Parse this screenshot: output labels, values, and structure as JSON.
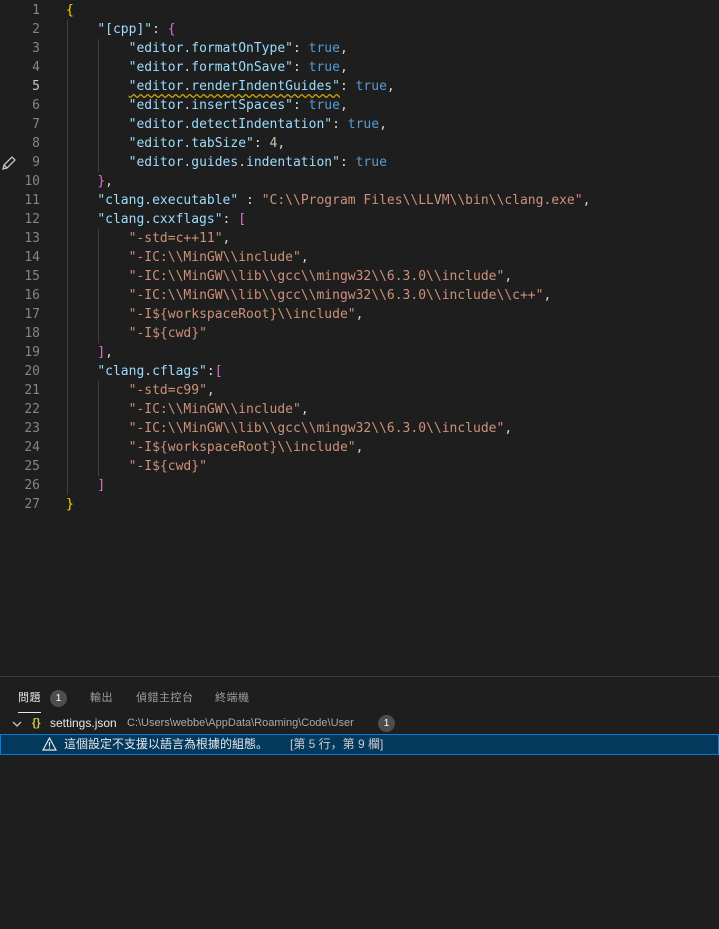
{
  "editor": {
    "active_line": 5,
    "pencil_icon": "pencil-icon",
    "lines": [
      {
        "n": "1",
        "tokens": [
          {
            "t": "{",
            "c": "t-b1"
          }
        ]
      },
      {
        "n": "2",
        "tokens": [
          {
            "t": "    "
          },
          {
            "t": "\"[cpp]\"",
            "c": "t-key"
          },
          {
            "t": ": ",
            "c": "t-p"
          },
          {
            "t": "{",
            "c": "t-b2"
          }
        ]
      },
      {
        "n": "3",
        "tokens": [
          {
            "t": "        "
          },
          {
            "t": "\"editor.formatOnType\"",
            "c": "t-key"
          },
          {
            "t": ": ",
            "c": "t-p"
          },
          {
            "t": "true",
            "c": "t-kw"
          },
          {
            "t": ",",
            "c": "t-p"
          }
        ]
      },
      {
        "n": "4",
        "tokens": [
          {
            "t": "        "
          },
          {
            "t": "\"editor.formatOnSave\"",
            "c": "t-key"
          },
          {
            "t": ": ",
            "c": "t-p"
          },
          {
            "t": "true",
            "c": "t-kw"
          },
          {
            "t": ",",
            "c": "t-p"
          }
        ]
      },
      {
        "n": "5",
        "tokens": [
          {
            "t": "        "
          },
          {
            "t": "\"editor.renderIndentGuides\"",
            "c": "t-key squiggle"
          },
          {
            "t": ": ",
            "c": "t-p"
          },
          {
            "t": "true",
            "c": "t-kw"
          },
          {
            "t": ",",
            "c": "t-p"
          }
        ]
      },
      {
        "n": "6",
        "tokens": [
          {
            "t": "        "
          },
          {
            "t": "\"editor.insertSpaces\"",
            "c": "t-key"
          },
          {
            "t": ": ",
            "c": "t-p"
          },
          {
            "t": "true",
            "c": "t-kw"
          },
          {
            "t": ",",
            "c": "t-p"
          }
        ]
      },
      {
        "n": "7",
        "tokens": [
          {
            "t": "        "
          },
          {
            "t": "\"editor.detectIndentation\"",
            "c": "t-key"
          },
          {
            "t": ": ",
            "c": "t-p"
          },
          {
            "t": "true",
            "c": "t-kw"
          },
          {
            "t": ",",
            "c": "t-p"
          }
        ]
      },
      {
        "n": "8",
        "tokens": [
          {
            "t": "        "
          },
          {
            "t": "\"editor.tabSize\"",
            "c": "t-key"
          },
          {
            "t": ": ",
            "c": "t-p"
          },
          {
            "t": "4",
            "c": "t-num"
          },
          {
            "t": ",",
            "c": "t-p"
          }
        ]
      },
      {
        "n": "9",
        "tokens": [
          {
            "t": "        "
          },
          {
            "t": "\"editor.guides.indentation\"",
            "c": "t-key"
          },
          {
            "t": ": ",
            "c": "t-p"
          },
          {
            "t": "true",
            "c": "t-kw"
          }
        ]
      },
      {
        "n": "10",
        "tokens": [
          {
            "t": "    "
          },
          {
            "t": "}",
            "c": "t-b2"
          },
          {
            "t": ",",
            "c": "t-p"
          }
        ]
      },
      {
        "n": "11",
        "tokens": [
          {
            "t": "    "
          },
          {
            "t": "\"clang.executable\"",
            "c": "t-key"
          },
          {
            "t": " : ",
            "c": "t-p"
          },
          {
            "t": "\"C:\\\\Program Files\\\\LLVM\\\\bin\\\\clang.exe\"",
            "c": "t-str"
          },
          {
            "t": ",",
            "c": "t-p"
          }
        ]
      },
      {
        "n": "12",
        "tokens": [
          {
            "t": "    "
          },
          {
            "t": "\"clang.cxxflags\"",
            "c": "t-key"
          },
          {
            "t": ": ",
            "c": "t-p"
          },
          {
            "t": "[",
            "c": "t-b2"
          }
        ]
      },
      {
        "n": "13",
        "tokens": [
          {
            "t": "        "
          },
          {
            "t": "\"-std=c++11\"",
            "c": "t-str"
          },
          {
            "t": ",",
            "c": "t-p"
          }
        ]
      },
      {
        "n": "14",
        "tokens": [
          {
            "t": "        "
          },
          {
            "t": "\"-IC:\\\\MinGW\\\\include\"",
            "c": "t-str"
          },
          {
            "t": ",",
            "c": "t-p"
          }
        ]
      },
      {
        "n": "15",
        "tokens": [
          {
            "t": "        "
          },
          {
            "t": "\"-IC:\\\\MinGW\\\\lib\\\\gcc\\\\mingw32\\\\6.3.0\\\\include\"",
            "c": "t-str"
          },
          {
            "t": ",",
            "c": "t-p"
          }
        ]
      },
      {
        "n": "16",
        "tokens": [
          {
            "t": "        "
          },
          {
            "t": "\"-IC:\\\\MinGW\\\\lib\\\\gcc\\\\mingw32\\\\6.3.0\\\\include\\\\c++\"",
            "c": "t-str"
          },
          {
            "t": ",",
            "c": "t-p"
          }
        ]
      },
      {
        "n": "17",
        "tokens": [
          {
            "t": "        "
          },
          {
            "t": "\"-I${workspaceRoot}\\\\include\"",
            "c": "t-str"
          },
          {
            "t": ",",
            "c": "t-p"
          }
        ]
      },
      {
        "n": "18",
        "tokens": [
          {
            "t": "        "
          },
          {
            "t": "\"-I${cwd}\"",
            "c": "t-str"
          }
        ]
      },
      {
        "n": "19",
        "tokens": [
          {
            "t": "    "
          },
          {
            "t": "]",
            "c": "t-b2"
          },
          {
            "t": ",",
            "c": "t-p"
          }
        ]
      },
      {
        "n": "20",
        "tokens": [
          {
            "t": "    "
          },
          {
            "t": "\"clang.cflags\"",
            "c": "t-key"
          },
          {
            "t": ":",
            "c": "t-p"
          },
          {
            "t": "[",
            "c": "t-b2"
          }
        ]
      },
      {
        "n": "21",
        "tokens": [
          {
            "t": "        "
          },
          {
            "t": "\"-std=c99\"",
            "c": "t-str"
          },
          {
            "t": ",",
            "c": "t-p"
          }
        ]
      },
      {
        "n": "22",
        "tokens": [
          {
            "t": "        "
          },
          {
            "t": "\"-IC:\\\\MinGW\\\\include\"",
            "c": "t-str"
          },
          {
            "t": ",",
            "c": "t-p"
          }
        ]
      },
      {
        "n": "23",
        "tokens": [
          {
            "t": "        "
          },
          {
            "t": "\"-IC:\\\\MinGW\\\\lib\\\\gcc\\\\mingw32\\\\6.3.0\\\\include\"",
            "c": "t-str"
          },
          {
            "t": ",",
            "c": "t-p"
          }
        ]
      },
      {
        "n": "24",
        "tokens": [
          {
            "t": "        "
          },
          {
            "t": "\"-I${workspaceRoot}\\\\include\"",
            "c": "t-str"
          },
          {
            "t": ",",
            "c": "t-p"
          }
        ]
      },
      {
        "n": "25",
        "tokens": [
          {
            "t": "        "
          },
          {
            "t": "\"-I${cwd}\"",
            "c": "t-str"
          }
        ]
      },
      {
        "n": "26",
        "tokens": [
          {
            "t": "    "
          },
          {
            "t": "]",
            "c": "t-b2"
          }
        ]
      },
      {
        "n": "27",
        "tokens": [
          {
            "t": "}",
            "c": "t-b1"
          }
        ]
      }
    ]
  },
  "panel": {
    "tabs": {
      "problems": "問題",
      "problems_count": "1",
      "output": "輸出",
      "debug_console": "偵錯主控台",
      "terminal": "終端機"
    },
    "file": {
      "icon_glyph": "{}",
      "name": "settings.json",
      "path": "C:\\Users\\webbe\\AppData\\Roaming\\Code\\User",
      "count": "1"
    },
    "problem": {
      "message": "這個設定不支援以語言為根據的組態。",
      "location": "[第 5 行，第 9 欄]"
    },
    "colors": {
      "warning": "#cca700",
      "selection": "#04395e",
      "focus_border": "#007fd4"
    }
  }
}
